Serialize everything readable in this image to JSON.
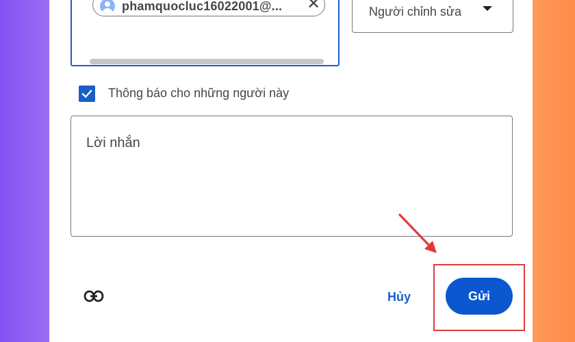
{
  "share_dialog": {
    "recipient_chip": {
      "email": "phamquocluc16022001@...",
      "close_glyph": "✕",
      "avatar_icon": "person-avatar-icon"
    },
    "role_select": {
      "value": "Người chỉnh sửa",
      "icon": "caret-down-icon"
    },
    "notify": {
      "label": "Thông báo cho những người này",
      "checked": true
    },
    "message": {
      "placeholder": "Lời nhắn"
    },
    "footer": {
      "copy_link_icon": "link-icon",
      "cancel_label": "Hủy",
      "send_label": "Gửi"
    }
  },
  "annotation": {
    "highlight_color": "#e03a3a",
    "arrow_color": "#e03a3a"
  },
  "colors": {
    "accent": "#1a5fc9",
    "primary_button": "#0b57d0"
  }
}
